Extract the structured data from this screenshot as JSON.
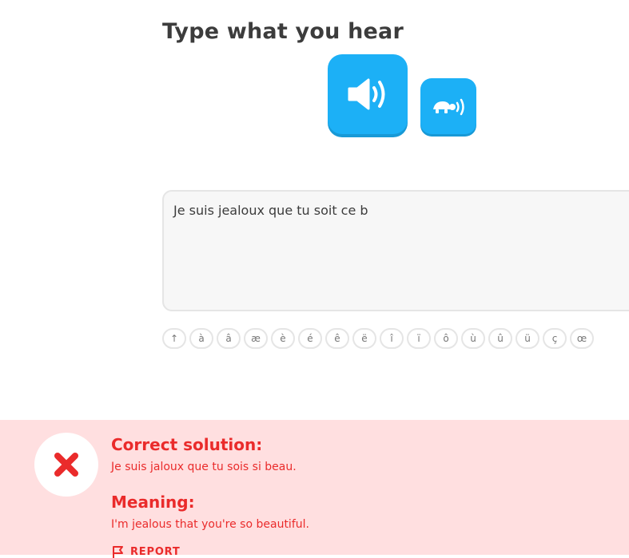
{
  "prompt": {
    "title": "Type what you hear"
  },
  "audio": {
    "play_icon": "speaker-icon",
    "slow_icon": "turtle-speaker-icon"
  },
  "answer": {
    "value": "Je suis jealoux que tu soit ce b"
  },
  "special_chars": [
    "↑",
    "à",
    "â",
    "æ",
    "è",
    "é",
    "ê",
    "ë",
    "î",
    "ï",
    "ô",
    "ù",
    "û",
    "ü",
    "ç",
    "œ"
  ],
  "feedback": {
    "status_icon": "x-icon",
    "correct_heading": "Correct solution:",
    "correct_text": "Je suis jaloux que tu sois si beau.",
    "meaning_heading": "Meaning:",
    "meaning_text": "I'm jealous that you're so beautiful.",
    "report_label": "REPORT",
    "accent_color": "#ea2b2b",
    "background_color": "#ffdfe0"
  },
  "colors": {
    "primary": "#1cb0f6",
    "primary_shadow": "#1899d6",
    "text": "#3c3c3c"
  }
}
